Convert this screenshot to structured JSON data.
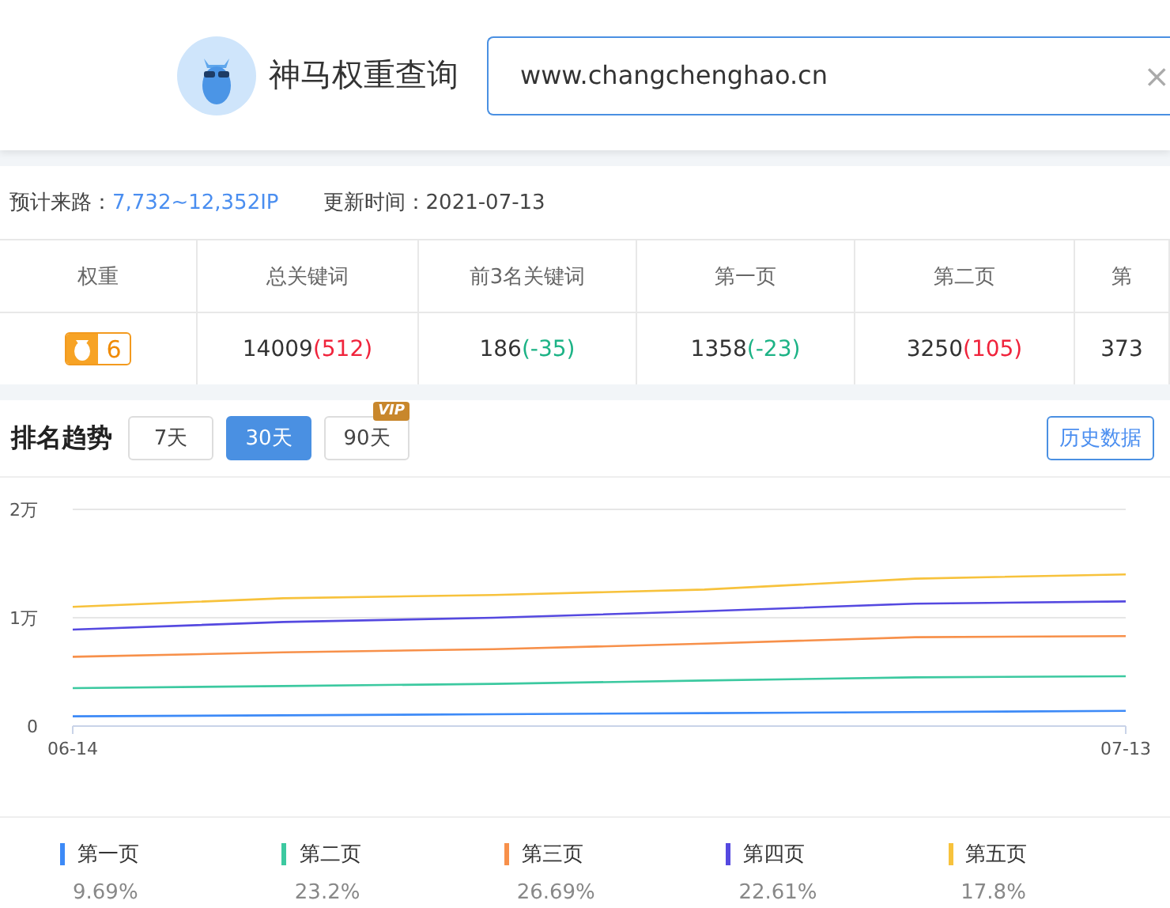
{
  "header": {
    "title": "神马权重查询",
    "search": {
      "value": "www.changchenghao.cn",
      "clear": "×"
    }
  },
  "info": [
    {
      "label": "预计来路：",
      "value": "7,732~12,352IP",
      "highlight": true
    },
    {
      "label": "更新时间：",
      "value": "2021-07-13",
      "highlight": false
    }
  ],
  "table": {
    "columns": [
      "权重",
      "总关键词",
      "前3名关键词",
      "第一页",
      "第二页",
      "第"
    ],
    "weight": "6",
    "cells": [
      {
        "value": "14009",
        "change": "(512)",
        "color": "#f0243c"
      },
      {
        "value": "186",
        "change": "(-35)",
        "color": "#1db386"
      },
      {
        "value": "1358",
        "change": "(-23)",
        "color": "#1db386"
      },
      {
        "value": "3250",
        "change": "(105)",
        "color": "#f0243c"
      },
      {
        "value": "373"
      }
    ]
  },
  "trend": {
    "title": "排名趋势",
    "ranges": [
      {
        "label": "7天",
        "selected": false
      },
      {
        "label": "30天",
        "selected": true
      },
      {
        "label": "90天",
        "selected": false,
        "badge": "VIP"
      }
    ],
    "history_button": "历史数据",
    "chart_data": {
      "type": "line",
      "categories": [
        "06-14",
        null,
        null,
        null,
        null,
        "07-13"
      ],
      "ylim": [
        0,
        2
      ],
      "yticks": [
        {
          "value": 0,
          "label": "0"
        },
        {
          "value": 1,
          "label": "1万"
        },
        {
          "value": 2,
          "label": "2万"
        }
      ],
      "series": [
        {
          "name": "第一页",
          "color": "#3d8af7",
          "values": [
            0.09,
            0.1,
            0.11,
            0.12,
            0.13,
            0.14
          ]
        },
        {
          "name": "第二页",
          "color": "#3cc9a0",
          "values": [
            0.35,
            0.37,
            0.39,
            0.42,
            0.45,
            0.46
          ]
        },
        {
          "name": "第三页",
          "color": "#f7904a",
          "values": [
            0.64,
            0.68,
            0.71,
            0.76,
            0.82,
            0.83
          ]
        },
        {
          "name": "第四页",
          "color": "#5549e0",
          "values": [
            0.89,
            0.96,
            1.0,
            1.06,
            1.13,
            1.15
          ]
        },
        {
          "name": "第五页",
          "color": "#f7c23c",
          "values": [
            1.1,
            1.18,
            1.21,
            1.26,
            1.36,
            1.4
          ]
        }
      ]
    },
    "legend_shares": [
      "9.69%",
      "23.2%",
      "26.69%",
      "22.61%",
      "17.8%"
    ]
  }
}
